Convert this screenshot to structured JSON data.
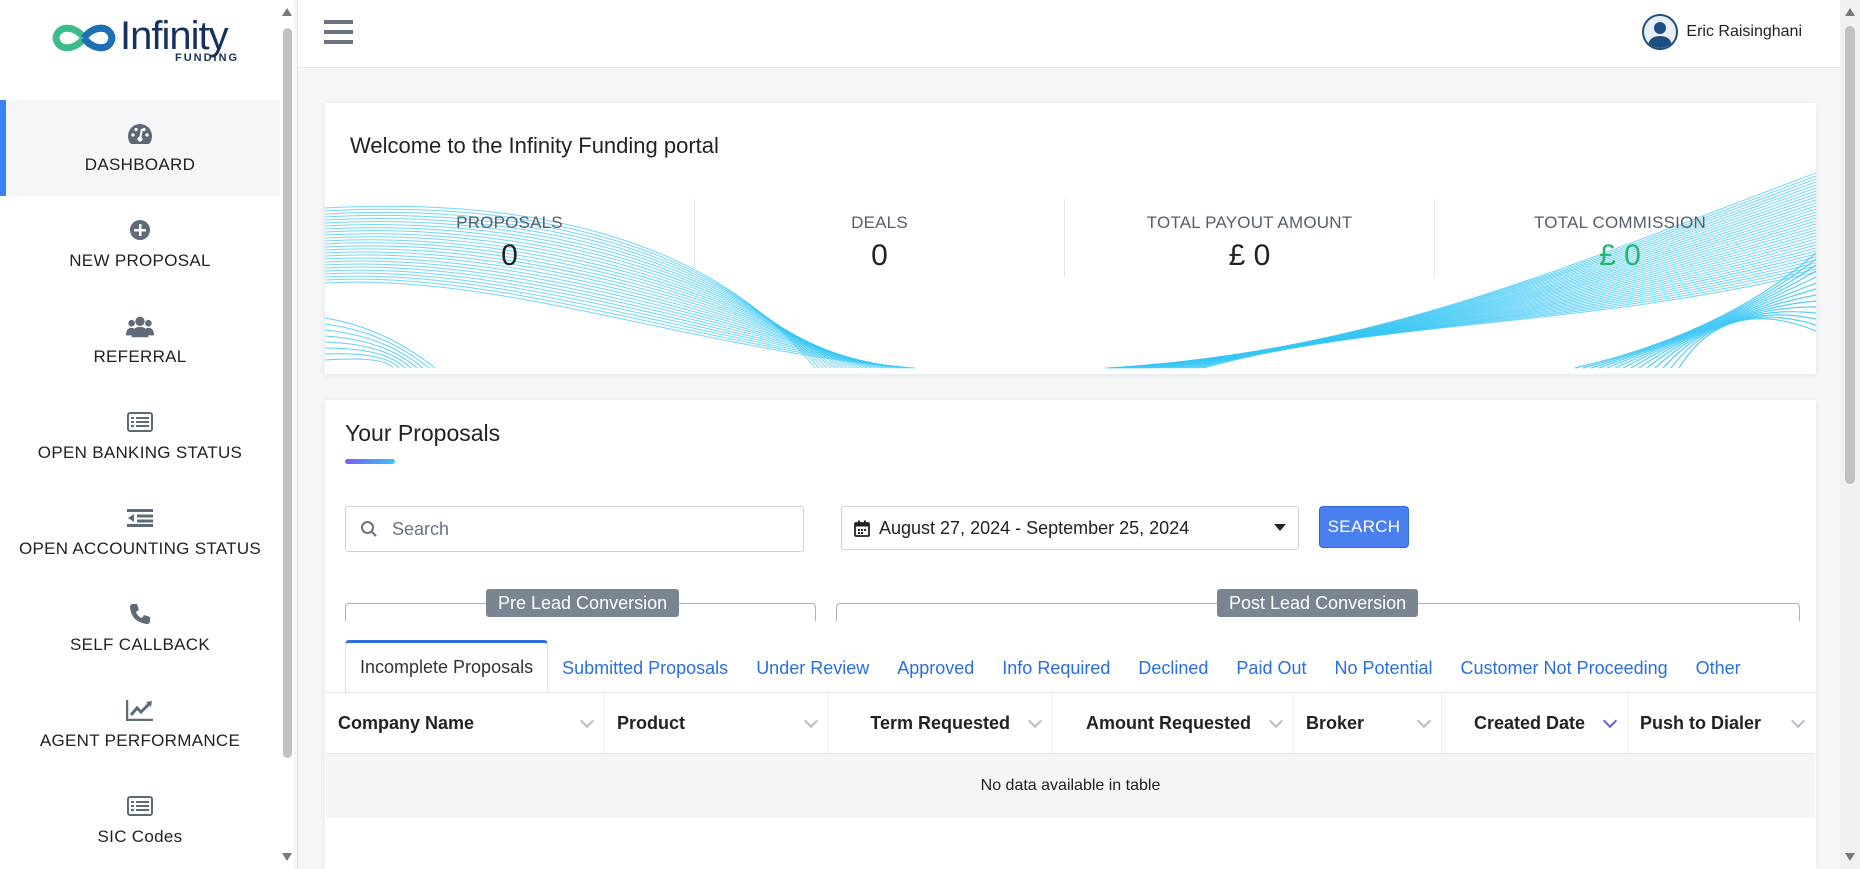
{
  "brand": {
    "name": "Infinity",
    "sub": "FUNDING"
  },
  "sidebar": {
    "items": [
      {
        "label": "DASHBOARD",
        "icon": "dashboard-gauge-icon"
      },
      {
        "label": "NEW PROPOSAL",
        "icon": "plus-circle-icon"
      },
      {
        "label": "REFERRAL",
        "icon": "users-icon"
      },
      {
        "label": "OPEN BANKING STATUS",
        "icon": "list-alt-icon"
      },
      {
        "label": "OPEN ACCOUNTING STATUS",
        "icon": "outdent-icon"
      },
      {
        "label": "SELF CALLBACK",
        "icon": "phone-icon"
      },
      {
        "label": "AGENT PERFORMANCE",
        "icon": "chart-line-icon"
      },
      {
        "label": "SIC Codes",
        "icon": "list-alt-icon"
      }
    ]
  },
  "header": {
    "user_name": "Eric Raisinghani"
  },
  "welcome": {
    "title": "Welcome to the Infinity Funding portal",
    "stats": [
      {
        "label": "PROPOSALS",
        "value": "0"
      },
      {
        "label": "DEALS",
        "value": "0"
      },
      {
        "label": "TOTAL PAYOUT AMOUNT",
        "value": "£ 0"
      },
      {
        "label": "TOTAL COMMISSION",
        "value": "£ 0"
      }
    ],
    "commission_color": "#22b573"
  },
  "proposals": {
    "title": "Your Proposals",
    "search_placeholder": "Search",
    "date_range": "August 27, 2024 - September 25, 2024",
    "search_button": "SEARCH",
    "groups": {
      "pre": "Pre Lead Conversion",
      "post": "Post Lead Conversion"
    },
    "tabs": [
      "Incomplete Proposals",
      "Submitted Proposals",
      "Under Review",
      "Approved",
      "Info Required",
      "Declined",
      "Paid Out",
      "No Potential",
      "Customer Not Proceeding",
      "Other"
    ],
    "columns": [
      "Company Name",
      "Product",
      "Term Requested",
      "Amount Requested",
      "Broker",
      "Created Date",
      "Push to Dialer"
    ],
    "empty_text": "No data available in table"
  },
  "colors": {
    "accent": "#3b82f6",
    "link": "#2a6fdb",
    "button": "#4a7ff0",
    "wave": "#38c6f4"
  }
}
